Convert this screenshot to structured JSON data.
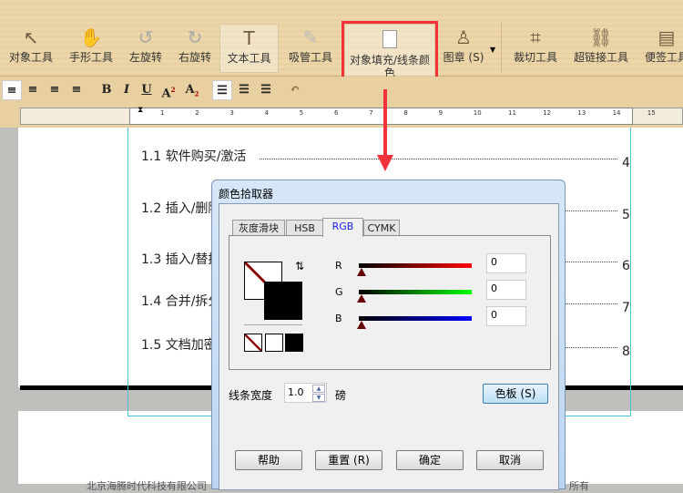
{
  "toolbar": {
    "items": [
      {
        "label": "对象工具",
        "icon": "cursor-icon"
      },
      {
        "label": "手形工具",
        "icon": "hand-icon"
      },
      {
        "label": "左旋转",
        "icon": "rotate-left-icon"
      },
      {
        "label": "右旋转",
        "icon": "rotate-right-icon"
      },
      {
        "label": "文本工具",
        "icon": "text-tool-icon"
      },
      {
        "label": "吸管工具",
        "icon": "eyedropper-icon"
      },
      {
        "label": "对象填充/线条颜色",
        "icon": "fill-color-icon"
      },
      {
        "label": "图章 (S)",
        "icon": "stamp-icon"
      },
      {
        "label": "裁切工具",
        "icon": "crop-icon"
      },
      {
        "label": "超链接工具",
        "icon": "link-icon"
      },
      {
        "label": "便签工具",
        "icon": "note-icon"
      }
    ]
  },
  "format": {
    "bold": "B",
    "italic": "I",
    "underline": "U",
    "superscript": "A",
    "subscript": "A",
    "sup_mark": "2",
    "sub_mark": "2"
  },
  "ruler": {
    "numbers": [
      "1",
      "2",
      "3",
      "4",
      "5",
      "6",
      "7",
      "8",
      "9",
      "10",
      "11",
      "12",
      "13",
      "14",
      "15"
    ]
  },
  "document": {
    "toc": [
      {
        "title": "1.1 软件购买/激活",
        "page": "4"
      },
      {
        "title": "1.2 插入/删除",
        "page": "5"
      },
      {
        "title": "1.3 插入/替换",
        "page": "6"
      },
      {
        "title": "1.4 合并/拆分",
        "page": "7"
      },
      {
        "title": "1.5 文档加密",
        "page": "8"
      }
    ],
    "footer_left": "北京海腾时代科技有限公司",
    "footer_right": "所有"
  },
  "dialog": {
    "title": "颜色拾取器",
    "tabs": [
      "灰度滑块",
      "HSB",
      "RGB",
      "CYMK"
    ],
    "active_tab": "RGB",
    "channels": [
      {
        "label": "R",
        "value": "0",
        "color": "#ff0000"
      },
      {
        "label": "G",
        "value": "0",
        "color": "#00ff00"
      },
      {
        "label": "B",
        "value": "0",
        "color": "#0000ff"
      }
    ],
    "line_width_label": "线条宽度",
    "line_width_value": "1.0",
    "unit": "磅",
    "palette_button": "色板 (S)",
    "buttons": {
      "help": "帮助",
      "reset": "重置 (R)",
      "ok": "确定",
      "cancel": "取消"
    }
  },
  "colors": {
    "highlight": "#f0333a",
    "frame": "#49c3d6",
    "active_tab": "#1a1af0"
  }
}
